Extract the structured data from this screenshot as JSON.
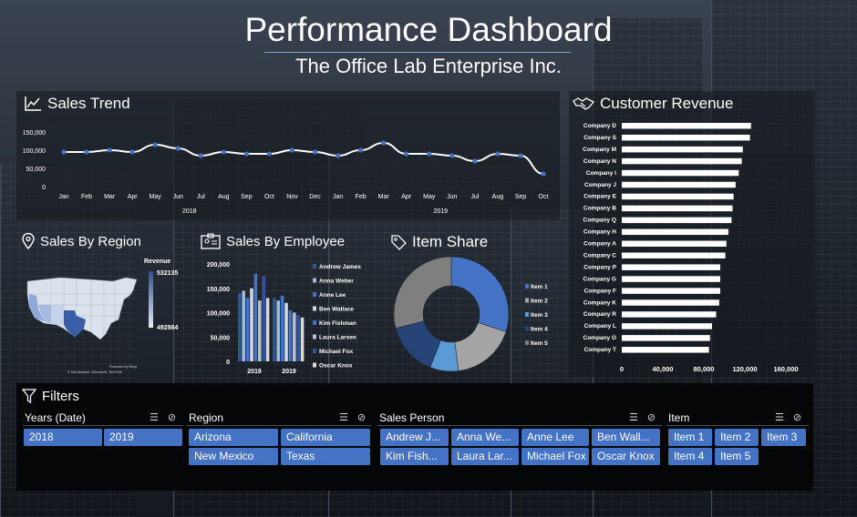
{
  "header": {
    "title": "Performance Dashboard",
    "subtitle": "The Office Lab Enterprise Inc."
  },
  "colors": {
    "accent": "#4472c4",
    "dark": "#050608",
    "white": "#ffffff"
  },
  "sales_trend": {
    "title": "Sales Trend",
    "icon": "line-chart-icon",
    "y_ticks": [
      "150,000",
      "100,000",
      "50,000",
      "0"
    ],
    "months": [
      "Jan",
      "Feb",
      "Mar",
      "Apr",
      "May",
      "Jun",
      "Jul",
      "Aug",
      "Sep",
      "Oct",
      "Nov",
      "Dec",
      "Jan",
      "Feb",
      "Mar",
      "Apr",
      "May",
      "Jun",
      "Jul",
      "Aug",
      "Sep",
      "Oct"
    ],
    "years": [
      "2018",
      "2019"
    ]
  },
  "customer_revenue": {
    "title": "Customer Revenue",
    "icon": "handshake-icon",
    "x_ticks": [
      "0",
      "40,000",
      "80,000",
      "120,000",
      "160,000"
    ]
  },
  "sales_by_region": {
    "title": "Sales By Region",
    "icon": "location-pin-icon",
    "legend_title": "Revenue",
    "legend_max": "532135",
    "legend_min": "492984",
    "map_credit_1": "Powered by Bing",
    "map_credit_2": "© GeoNames, Microsoft, TomTom"
  },
  "sales_by_employee": {
    "title": "Sales By Employee",
    "icon": "id-badge-icon",
    "y_ticks": [
      "200,000",
      "150,000",
      "100,000",
      "50,000",
      "0"
    ],
    "years": [
      "2018",
      "2019"
    ]
  },
  "item_share": {
    "title": "Item Share",
    "icon": "tag-icon"
  },
  "filters": {
    "title": "Filters",
    "icon": "funnel-icon",
    "years": {
      "label": "Years (Date)",
      "options": [
        "2018",
        "2019"
      ]
    },
    "region": {
      "label": "Region",
      "options": [
        "Arizona",
        "California",
        "New Mexico",
        "Texas"
      ]
    },
    "sales_person": {
      "label": "Sales Person",
      "options": [
        "Andrew J...",
        "Anna We...",
        "Anne Lee",
        "Ben Wall...",
        "Kim Fish...",
        "Laura Lar...",
        "Michael Fox",
        "Oscar Knox"
      ]
    },
    "item": {
      "label": "Item",
      "options": [
        "Item 1",
        "Item 2",
        "Item 3",
        "Item 4",
        "Item 5"
      ]
    }
  },
  "chart_data": [
    {
      "type": "line",
      "title": "Sales Trend",
      "x": [
        "Jan 2018",
        "Feb 2018",
        "Mar 2018",
        "Apr 2018",
        "May 2018",
        "Jun 2018",
        "Jul 2018",
        "Aug 2018",
        "Sep 2018",
        "Oct 2018",
        "Nov 2018",
        "Dec 2018",
        "Jan 2019",
        "Feb 2019",
        "Mar 2019",
        "Apr 2019",
        "May 2019",
        "Jun 2019",
        "Jul 2019",
        "Aug 2019",
        "Sep 2019",
        "Oct 2019"
      ],
      "values": [
        95000,
        95000,
        100000,
        95000,
        115000,
        105000,
        85000,
        95000,
        90000,
        90000,
        100000,
        95000,
        85000,
        100000,
        120000,
        90000,
        90000,
        85000,
        70000,
        90000,
        85000,
        35000
      ],
      "ylim": [
        0,
        150000
      ]
    },
    {
      "type": "bar",
      "title": "Customer Revenue",
      "orientation": "horizontal",
      "categories": [
        "Company D",
        "Company S",
        "Company M",
        "Company N",
        "Company I",
        "Company J",
        "Company E",
        "Company B",
        "Company Q",
        "Company H",
        "Company A",
        "Company C",
        "Company P",
        "Company G",
        "Company F",
        "Company K",
        "Company R",
        "Company L",
        "Company O",
        "Company T"
      ],
      "values": [
        126000,
        125000,
        118000,
        117000,
        114000,
        111000,
        109000,
        108000,
        107000,
        104000,
        102000,
        101000,
        96000,
        96000,
        96000,
        95000,
        92000,
        88000,
        86000,
        85000
      ],
      "xlim": [
        0,
        160000
      ]
    },
    {
      "type": "bar",
      "title": "Sales By Employee",
      "categories": [
        "2018",
        "2019"
      ],
      "series": [
        {
          "name": "Andrew James",
          "values": [
            140000,
            130000
          ]
        },
        {
          "name": "Anna Weber",
          "values": [
            145000,
            125000
          ]
        },
        {
          "name": "Anne Lee",
          "values": [
            130000,
            135000
          ]
        },
        {
          "name": "Ben Wallace",
          "values": [
            150000,
            120000
          ]
        },
        {
          "name": "Kim Fishman",
          "values": [
            180000,
            105000
          ]
        },
        {
          "name": "Laura Larsen",
          "values": [
            125000,
            100000
          ]
        },
        {
          "name": "Michael Fox",
          "values": [
            175000,
            95000
          ]
        },
        {
          "name": "Oscar Knox",
          "values": [
            130000,
            90000
          ]
        }
      ],
      "ylim": [
        0,
        200000
      ]
    },
    {
      "type": "pie",
      "title": "Item Share",
      "categories": [
        "Item 1",
        "Item 2",
        "Item 3",
        "Item 4",
        "Item 5"
      ],
      "values": [
        30,
        18,
        8,
        15,
        29
      ]
    }
  ]
}
